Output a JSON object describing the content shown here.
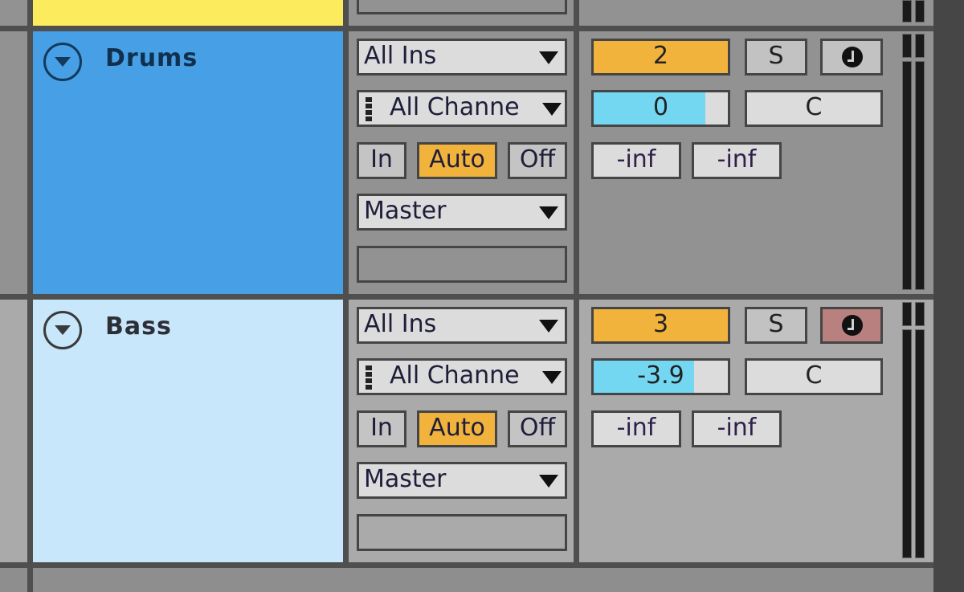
{
  "tracks": [
    {
      "name": "Drums",
      "color": "#47a0e6",
      "input_type": "All Ins",
      "input_channel": "All Channe",
      "monitor": {
        "in": "In",
        "auto": "Auto",
        "off": "Off",
        "selected": "Auto"
      },
      "output": "Master",
      "track_number": "2",
      "solo_label": "S",
      "arm_active": false,
      "volume": "0",
      "volume_fill_fraction": 0.83,
      "pan": "C",
      "peak_left": "-inf",
      "peak_right": "-inf"
    },
    {
      "name": "Bass",
      "color": "#c8e7fb",
      "input_type": "All Ins",
      "input_channel": "All Channe",
      "monitor": {
        "in": "In",
        "auto": "Auto",
        "off": "Off",
        "selected": "Auto"
      },
      "output": "Master",
      "track_number": "3",
      "solo_label": "S",
      "arm_active": true,
      "volume": "-3.9",
      "volume_fill_fraction": 0.75,
      "pan": "C",
      "peak_left": "-inf",
      "peak_right": "-inf"
    }
  ],
  "top_track_color": "#fdeb5e",
  "colors": {
    "monitor_active": "#f2b33d",
    "track_number": "#f2b33d",
    "volume_fill": "#74d7f2",
    "arm_active": "#b8807e"
  }
}
